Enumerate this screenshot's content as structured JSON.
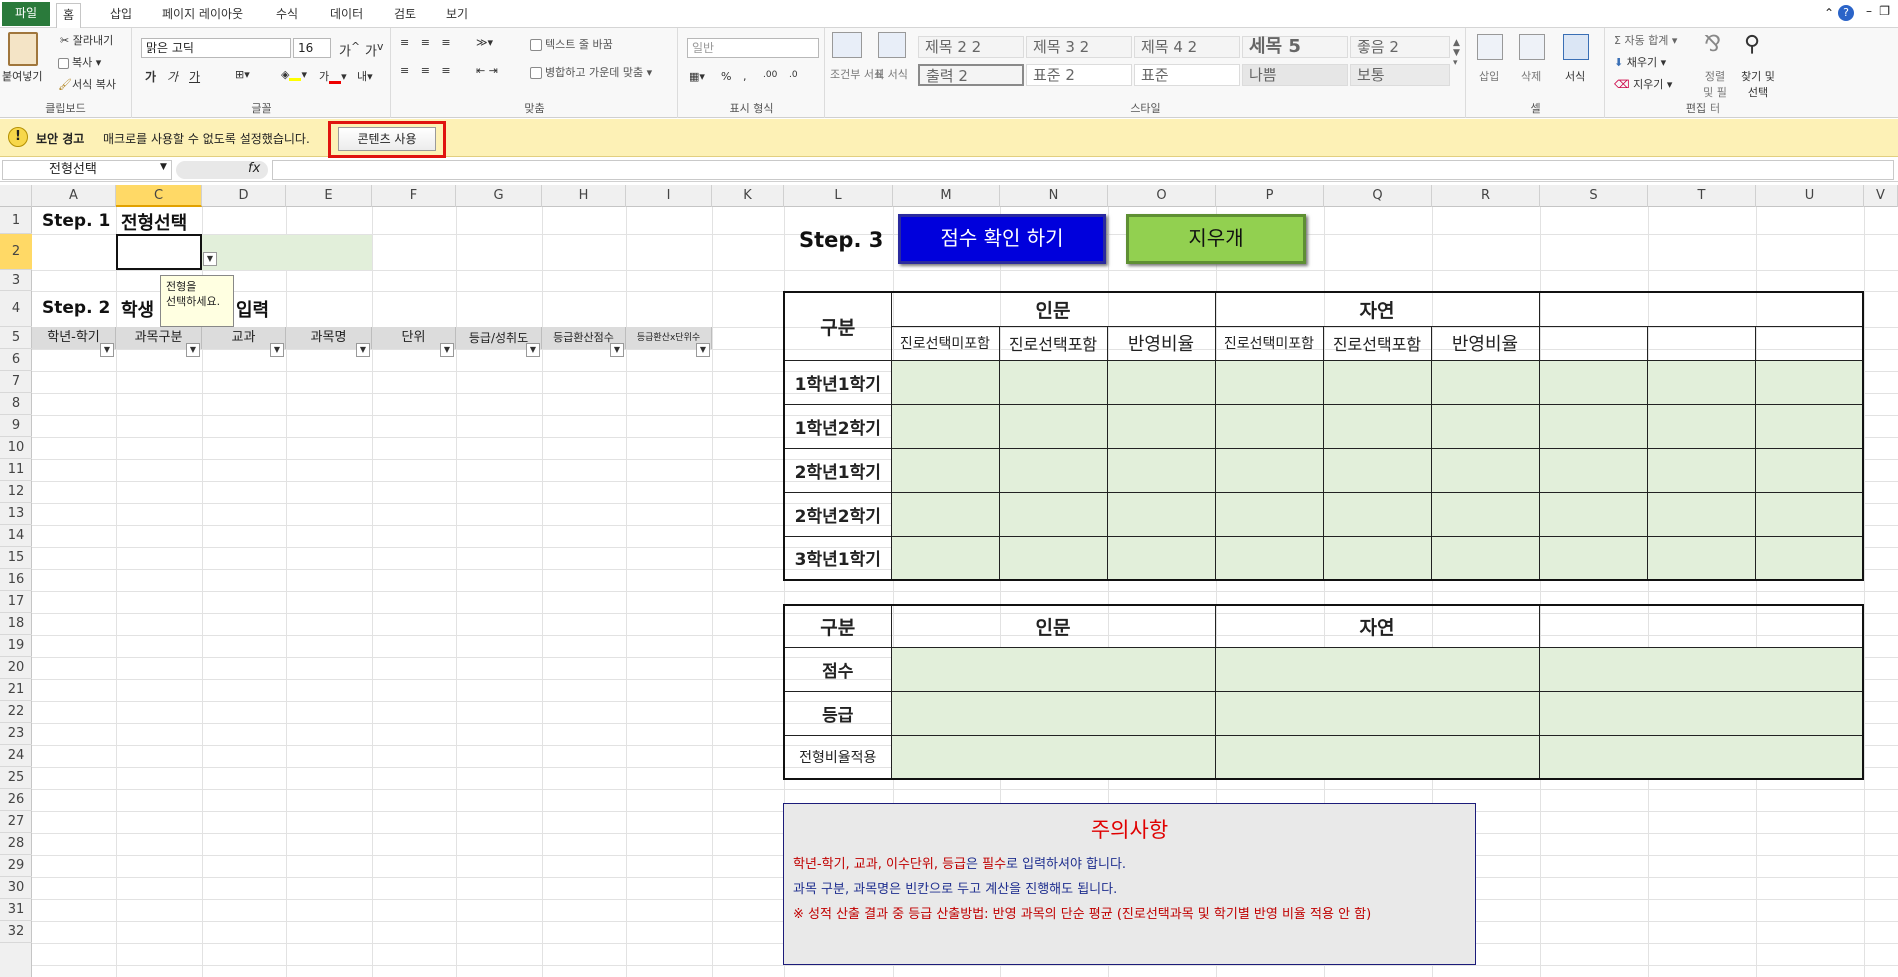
{
  "tabs": [
    "파일",
    "홈",
    "삽입",
    "페이지 레이아웃",
    "수식",
    "데이터",
    "검토",
    "보기"
  ],
  "ribbon": {
    "clipboard": {
      "paste": "붙여넣기",
      "cut": "잘라내기",
      "copy": "복사",
      "format_painter": "서식 복사",
      "label": "클립보드"
    },
    "font": {
      "name": "맑은 고딕",
      "size": "16",
      "bold": "가",
      "italic": "가",
      "underline": "가",
      "label": "글꼴"
    },
    "align": {
      "wrap": "텍스트 줄 바꿈",
      "merge": "병합하고 가운데 맞춤",
      "label": "맞춤"
    },
    "number": {
      "format": "일반",
      "percent": "%",
      "comma": ",",
      "label": "표시 형식"
    },
    "styles": {
      "cond": "조건부 서식",
      "table": "표 서식",
      "items": [
        "제목 2 2",
        "제목 3 2",
        "제목 4 2",
        "세목 5",
        "좋음 2",
        "출력 2",
        "표준 2",
        "표준",
        "나쁨",
        "보통"
      ],
      "label": "스타일"
    },
    "cells": {
      "insert": "삽입",
      "delete": "삭제",
      "format": "서식",
      "label": "셀"
    },
    "edit": {
      "autosum": "자동 합계",
      "fill": "채우기",
      "clear": "지우기",
      "sort": "정렬 및 필터",
      "find": "찾기 및 선택",
      "label": "편집"
    }
  },
  "security": {
    "title": "보안 경고",
    "message": "매크로를 사용할 수 없도록 설정했습니다.",
    "button": "콘텐츠 사용"
  },
  "formula": {
    "name_box": "전형선택",
    "fx": "fx",
    "value": ""
  },
  "columns": [
    "A",
    "C",
    "D",
    "E",
    "F",
    "G",
    "H",
    "I",
    "K",
    "L",
    "M",
    "N",
    "O",
    "P",
    "Q",
    "R",
    "S",
    "T",
    "U",
    "V"
  ],
  "rows": [
    "1",
    "2",
    "3",
    "4",
    "5",
    "6",
    "7",
    "8",
    "9",
    "10",
    "11",
    "12",
    "13",
    "14",
    "15",
    "16",
    "17",
    "18",
    "19",
    "20",
    "21",
    "22",
    "23",
    "24",
    "25",
    "26",
    "27",
    "28",
    "29",
    "30",
    "31",
    "32"
  ],
  "left": {
    "step1": "Step. 1",
    "step1_title": "전형선택",
    "tooltip_line1": "전형을",
    "tooltip_line2": "선택하세요.",
    "step2": "Step. 2",
    "step2_title_a": "학생",
    "step2_title_b": "입력",
    "headers": [
      "학년-학기",
      "과목구분",
      "교과",
      "과목명",
      "단위",
      "등급/성취도",
      "등급환산점수",
      "등급환산x단위수"
    ]
  },
  "step3": {
    "label": "Step. 3",
    "btn_check": "점수 확인 하기",
    "btn_clear": "지우개"
  },
  "table1": {
    "gubun": "구분",
    "inmun": "인문",
    "jayeon": "자연",
    "sub": [
      "진로선택미포함",
      "진로선택포함",
      "반영비율",
      "진로선택미포함",
      "진로선택포함",
      "반영비율"
    ],
    "rows": [
      "1학년1학기",
      "1학년2학기",
      "2학년1학기",
      "2학년2학기",
      "3학년1학기"
    ]
  },
  "table2": {
    "gubun": "구분",
    "inmun": "인문",
    "jayeon": "자연",
    "rows": [
      "점수",
      "등급",
      "전형비율적용"
    ]
  },
  "notice": {
    "title": "주의사항",
    "line1_a": "학년-학기, 교과, 이수단위, 등급",
    "line1_b": "은 ",
    "line1_c": "필수",
    "line1_d": "로 입력하셔야 합니다.",
    "line2": "과목 구분, 과목명은 빈칸으로 두고 계산을 진행해도 됩니다.",
    "line3": "※ 성적 산출 결과 중 등급 산출방법: 반영 과목의 단순 평균 (진로선택과목 및 학기별 반영 비율 적용 안 함)"
  },
  "colors": {
    "accent_green": "#92d050",
    "button_blue": "#0000dc",
    "cell_fill": "#e2efda",
    "warn_red": "#e0130f",
    "sec_bar": "#fdf1b6"
  }
}
